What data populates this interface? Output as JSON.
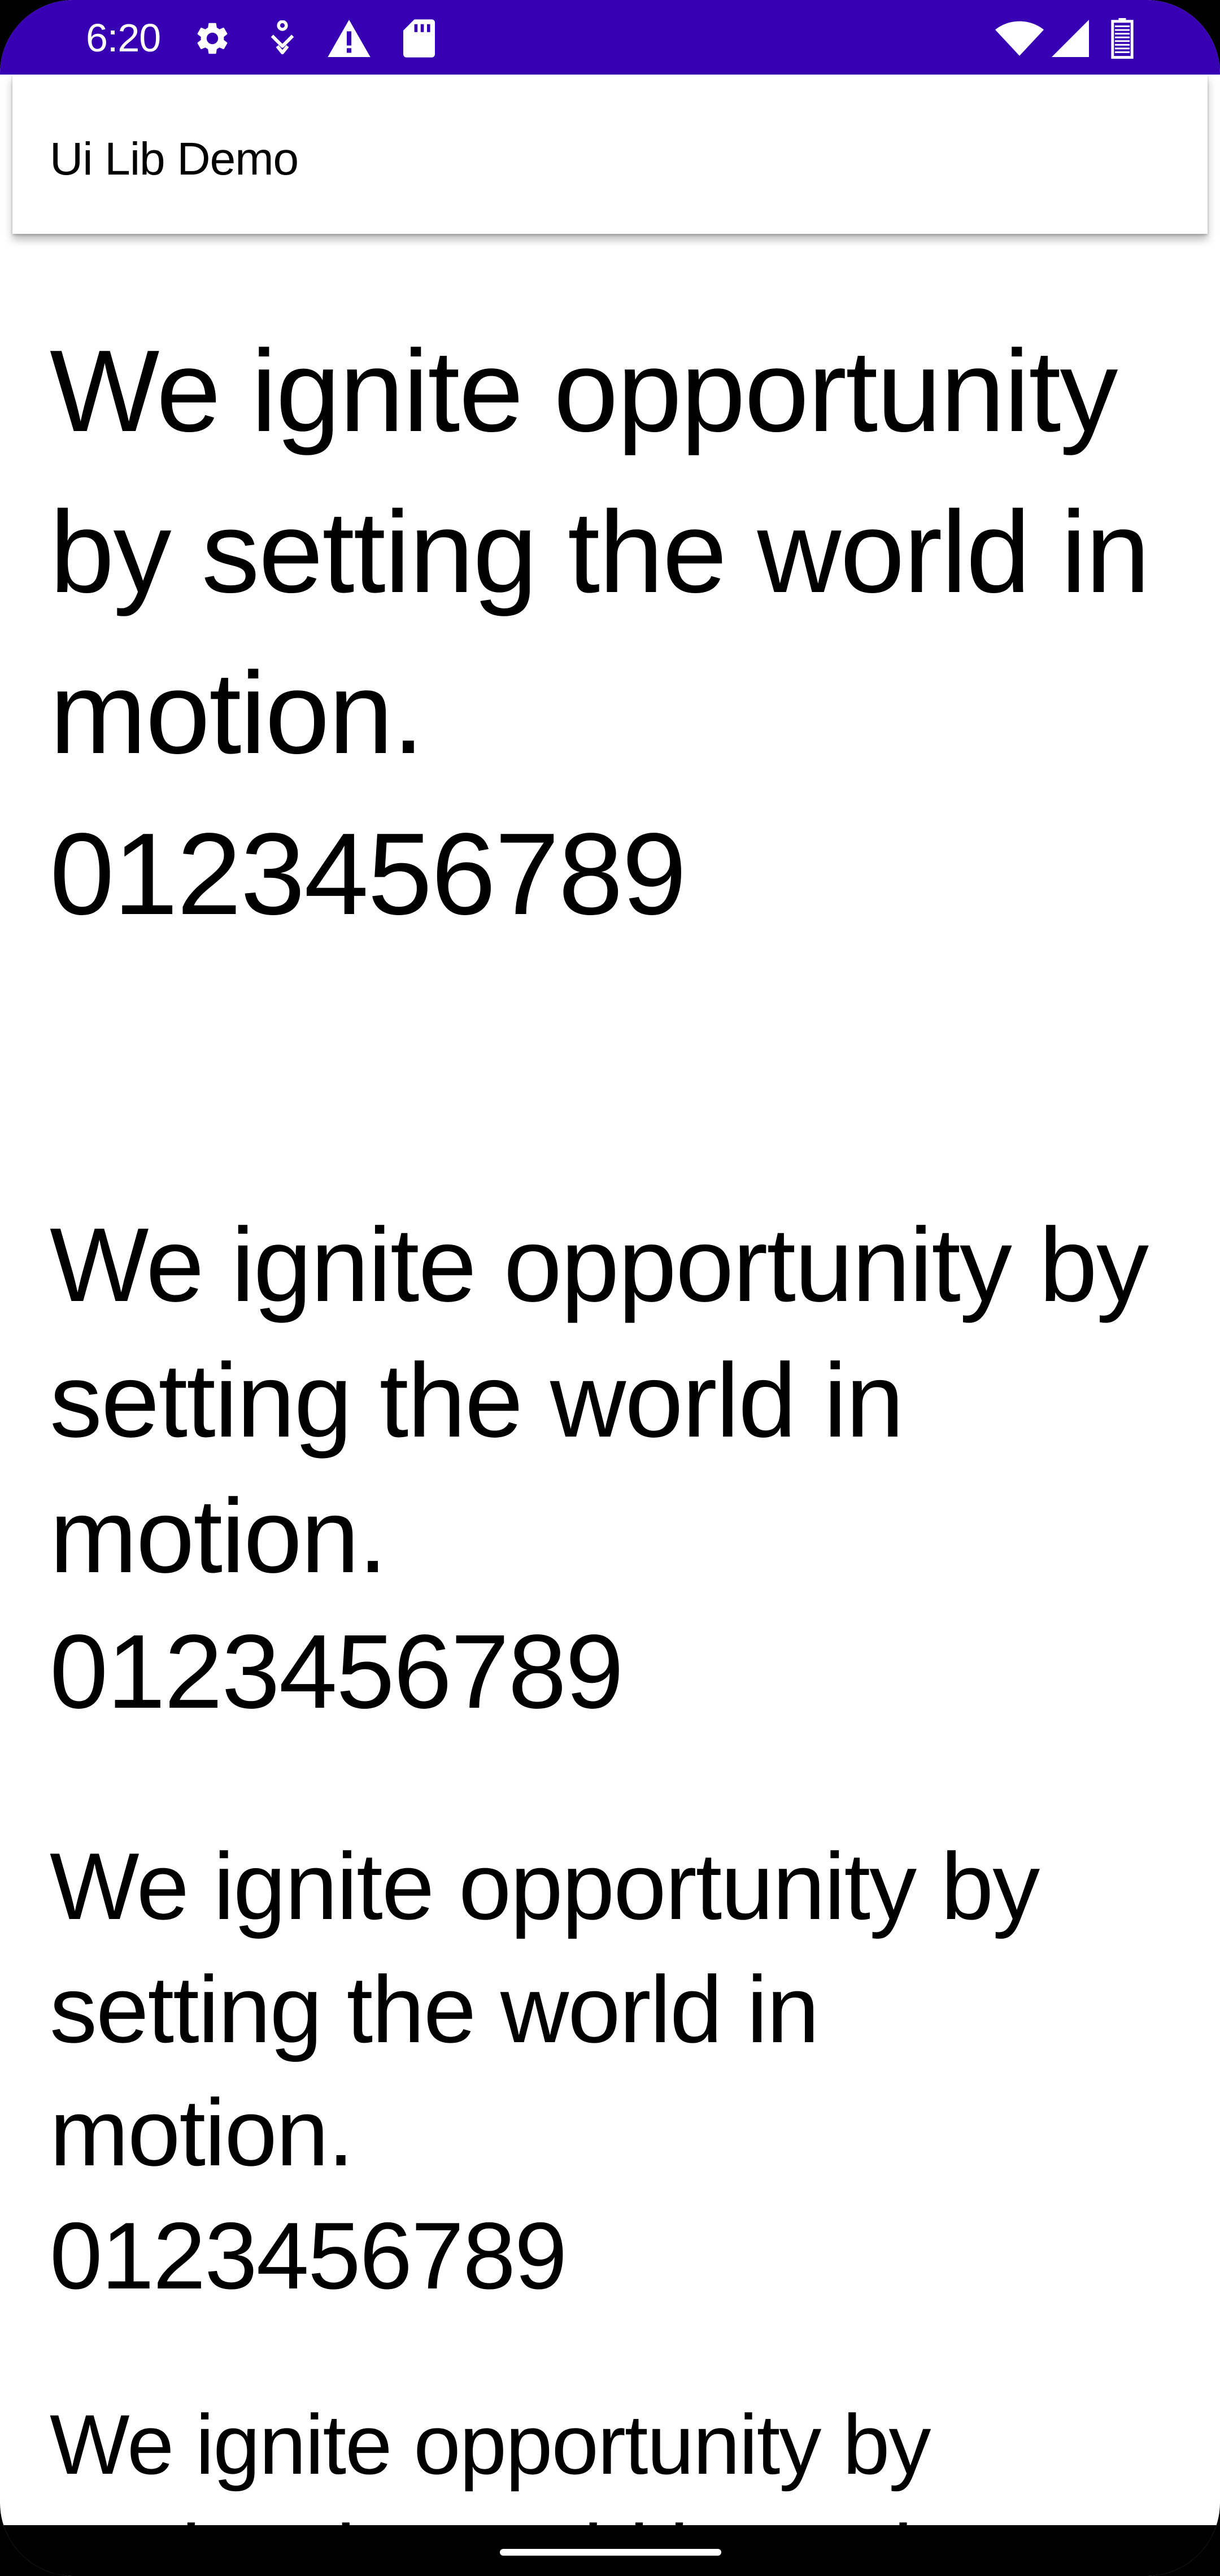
{
  "status_bar": {
    "time": "6:20",
    "background_color": "#3700b3",
    "left_icons": [
      "settings-gear-icon",
      "accessibility-icon",
      "warning-icon",
      "sd-card-icon"
    ],
    "right_icons": [
      "wifi-icon",
      "cellular-signal-icon",
      "battery-icon"
    ]
  },
  "app_bar": {
    "title": "Ui Lib Demo"
  },
  "samples": [
    {
      "text": "We ignite opportunity by setting the world in motion.",
      "digits": "0123456789"
    },
    {
      "text": "We ignite opportunity by setting the world in motion.",
      "digits": "0123456789"
    },
    {
      "text": "We ignite opportunity by setting the world in motion.",
      "digits": "0123456789"
    },
    {
      "text": "We ignite opportunity by setting the world in motion."
    }
  ]
}
